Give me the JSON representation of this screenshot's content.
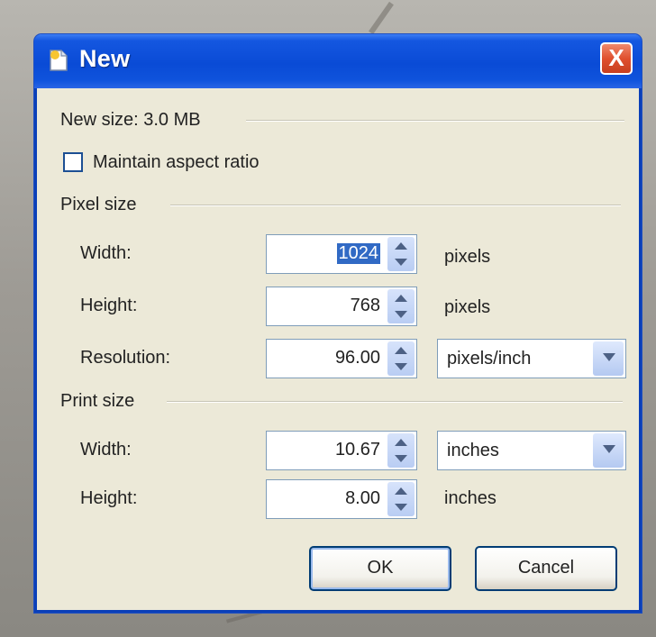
{
  "dialog": {
    "title": "New",
    "close_glyph": "X",
    "icons": {
      "title": "new-document-icon",
      "close": "close-icon"
    }
  },
  "new_size_label": "New size: 3.0 MB",
  "maintain_aspect": {
    "label": "Maintain aspect ratio",
    "checked": false
  },
  "pixel_size": {
    "heading": "Pixel size",
    "width": {
      "label": "Width:",
      "value": "1024",
      "unit": "pixels"
    },
    "height": {
      "label": "Height:",
      "value": "768",
      "unit": "pixels"
    },
    "resolution": {
      "label": "Resolution:",
      "value": "96.00",
      "unit": "pixels/inch"
    }
  },
  "print_size": {
    "heading": "Print size",
    "width": {
      "label": "Width:",
      "value": "10.67",
      "unit": "inches"
    },
    "height": {
      "label": "Height:",
      "value": "8.00",
      "unit": "inches"
    }
  },
  "buttons": {
    "ok": "OK",
    "cancel": "Cancel"
  },
  "colors": {
    "titlebar": "#0a4bd6",
    "close": "#e0502e",
    "dialog_bg": "#ece9d8",
    "selection": "#316ac5"
  }
}
